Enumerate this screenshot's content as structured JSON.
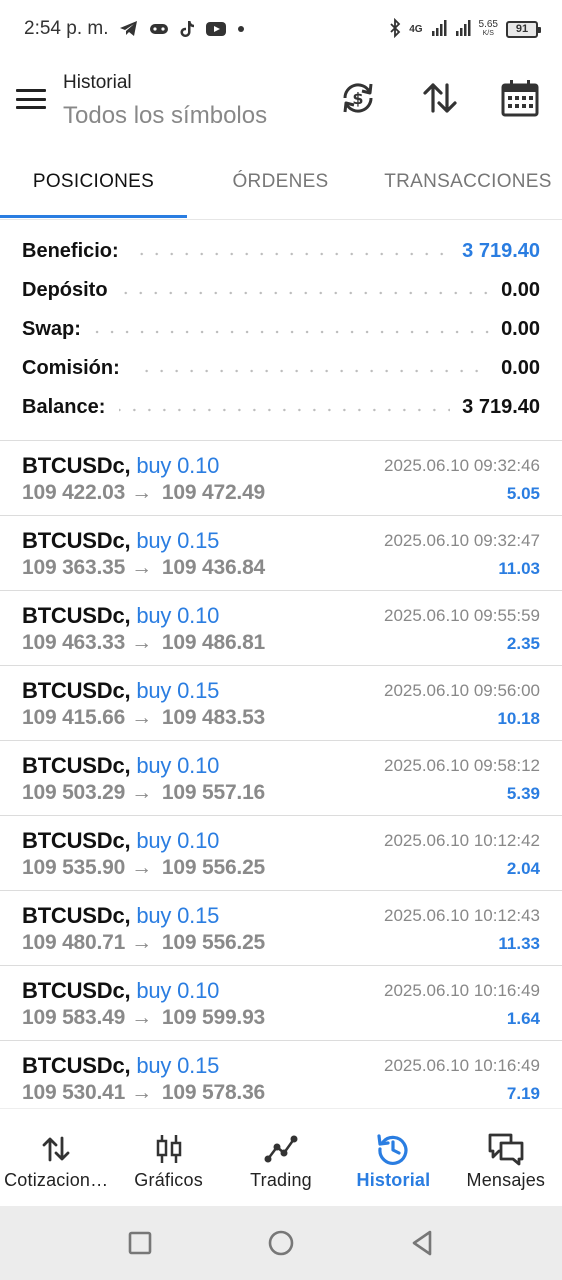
{
  "status_bar": {
    "time": "2:54 p. m.",
    "net_speed_value": "5.65",
    "net_speed_unit": "K/S",
    "network_label": "4G",
    "battery": "91"
  },
  "header": {
    "title": "Historial",
    "subtitle": "Todos los símbolos"
  },
  "tabs": [
    {
      "label": "POSICIONES",
      "active": true
    },
    {
      "label": "ÓRDENES",
      "active": false
    },
    {
      "label": "TRANSACCIONES",
      "active": false
    }
  ],
  "summary": [
    {
      "label": "Beneficio:",
      "value": "3 719.40"
    },
    {
      "label": "Depósito",
      "value": "0.00"
    },
    {
      "label": "Swap:",
      "value": "0.00"
    },
    {
      "label": "Comisión:",
      "value": "0.00"
    },
    {
      "label": "Balance:",
      "value": "3 719.40"
    }
  ],
  "positions": [
    {
      "symbol": "BTCUSDc,",
      "side": "buy 0.10",
      "open_price": "109 422.03",
      "arrow": "→",
      "close_price": "109 472.49",
      "time": "2025.06.10 09:32:46",
      "profit": "5.05"
    },
    {
      "symbol": "BTCUSDc,",
      "side": "buy 0.15",
      "open_price": "109 363.35",
      "arrow": "→",
      "close_price": "109 436.84",
      "time": "2025.06.10 09:32:47",
      "profit": "11.03"
    },
    {
      "symbol": "BTCUSDc,",
      "side": "buy 0.10",
      "open_price": "109 463.33",
      "arrow": "→",
      "close_price": "109 486.81",
      "time": "2025.06.10 09:55:59",
      "profit": "2.35"
    },
    {
      "symbol": "BTCUSDc,",
      "side": "buy 0.15",
      "open_price": "109 415.66",
      "arrow": "→",
      "close_price": "109 483.53",
      "time": "2025.06.10 09:56:00",
      "profit": "10.18"
    },
    {
      "symbol": "BTCUSDc,",
      "side": "buy 0.10",
      "open_price": "109 503.29",
      "arrow": "→",
      "close_price": "109 557.16",
      "time": "2025.06.10 09:58:12",
      "profit": "5.39"
    },
    {
      "symbol": "BTCUSDc,",
      "side": "buy 0.10",
      "open_price": "109 535.90",
      "arrow": "→",
      "close_price": "109 556.25",
      "time": "2025.06.10 10:12:42",
      "profit": "2.04"
    },
    {
      "symbol": "BTCUSDc,",
      "side": "buy 0.15",
      "open_price": "109 480.71",
      "arrow": "→",
      "close_price": "109 556.25",
      "time": "2025.06.10 10:12:43",
      "profit": "11.33"
    },
    {
      "symbol": "BTCUSDc,",
      "side": "buy 0.10",
      "open_price": "109 583.49",
      "arrow": "→",
      "close_price": "109 599.93",
      "time": "2025.06.10 10:16:49",
      "profit": "1.64"
    },
    {
      "symbol": "BTCUSDc,",
      "side": "buy 0.15",
      "open_price": "109 530.41",
      "arrow": "→",
      "close_price": "109 578.36",
      "time": "2025.06.10 10:16:49",
      "profit": "7.19"
    }
  ],
  "bottom_nav": [
    {
      "label": "Cotizacion…",
      "icon": "arrows-updown-icon",
      "active": false
    },
    {
      "label": "Gráficos",
      "icon": "candlestick-icon",
      "active": false
    },
    {
      "label": "Trading",
      "icon": "trend-line-icon",
      "active": false
    },
    {
      "label": "Historial",
      "icon": "history-icon",
      "active": true
    },
    {
      "label": "Mensajes",
      "icon": "chat-bubbles-icon",
      "active": false
    }
  ],
  "colors": {
    "accent": "#2a7de1",
    "muted_text": "#8a8a8a",
    "system_bar": "#ececec"
  }
}
